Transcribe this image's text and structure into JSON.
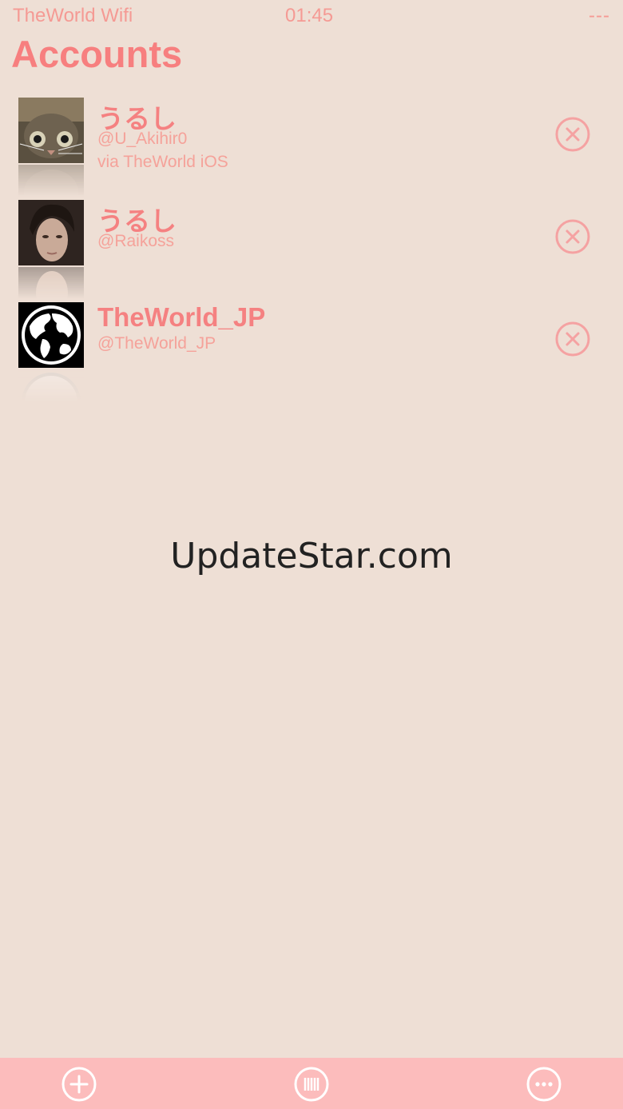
{
  "status_bar": {
    "carrier": "TheWorld Wifi",
    "time": "01:45",
    "battery": "---"
  },
  "page": {
    "title": "Accounts"
  },
  "accounts": [
    {
      "name": "うるし",
      "handle": "@U_Akihir0",
      "via": "via TheWorld iOS",
      "avatar": "cat-avatar"
    },
    {
      "name": "うるし",
      "handle": "@Raikoss",
      "via": "",
      "avatar": "woman-portrait-avatar"
    },
    {
      "name": "TheWorld_JP",
      "handle": "@TheWorld_JP",
      "via": "",
      "avatar": "globe-avatar"
    }
  ],
  "watermark": "UpdateStar.com",
  "toolbar": {
    "buttons": [
      "add-icon",
      "barcode-icon",
      "more-icon"
    ]
  },
  "colors": {
    "background": "#eedfd5",
    "accent": "#f77f7f",
    "toolbar": "#fcbcbc"
  }
}
